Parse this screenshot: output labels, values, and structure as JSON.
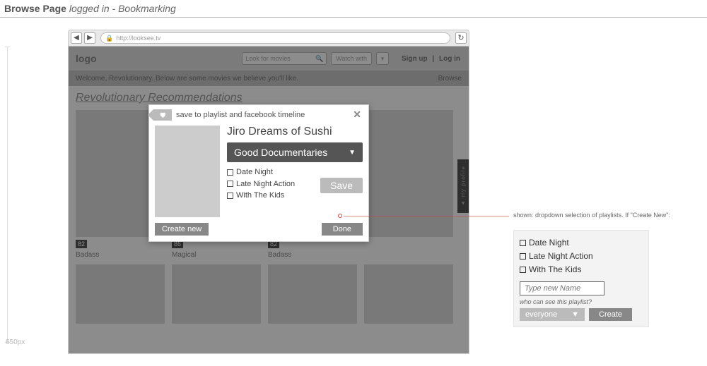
{
  "page": {
    "title_bold": "Browse Page",
    "title_rest": "logged in - Bookmarking"
  },
  "ruler": {
    "height_label": "650px"
  },
  "browser": {
    "url": "http://looksee.tv"
  },
  "header": {
    "logo": "logo",
    "search_placeholder": "Look for movies",
    "watch_with": "Watch with",
    "signup": "Sign up",
    "login": "Log in"
  },
  "welcome": {
    "text": "Welcome, Revolutionary. Below are some movies we believe you'll like.",
    "browse": "Browse"
  },
  "section": {
    "title": "Revolutionary Recommendations"
  },
  "cards": [
    {
      "rating": "82",
      "title": "Badass"
    },
    {
      "rating": "86",
      "title": "Magical"
    },
    {
      "rating": "82",
      "title": "Badass"
    },
    {
      "rating": "",
      "title": ""
    }
  ],
  "profile_tab": "▲ my profile",
  "modal": {
    "head": "save to playlist and facebook timeline",
    "movie": "Jiro Dreams of Sushi",
    "dropdown": "Good Documentaries",
    "options": [
      "Date Night",
      "Late Night Action",
      "With The Kids"
    ],
    "save": "Save",
    "create_new": "Create new",
    "done": "Done"
  },
  "callout": {
    "text": "shown: dropdown selection of playlists. If \"Create New\":"
  },
  "side": {
    "options": [
      "Date Night",
      "Late Night Action",
      "With The Kids"
    ],
    "input_placeholder": "Type new Name",
    "question": "who can see this playlist?",
    "visibility": "everyone",
    "create": "Create"
  }
}
